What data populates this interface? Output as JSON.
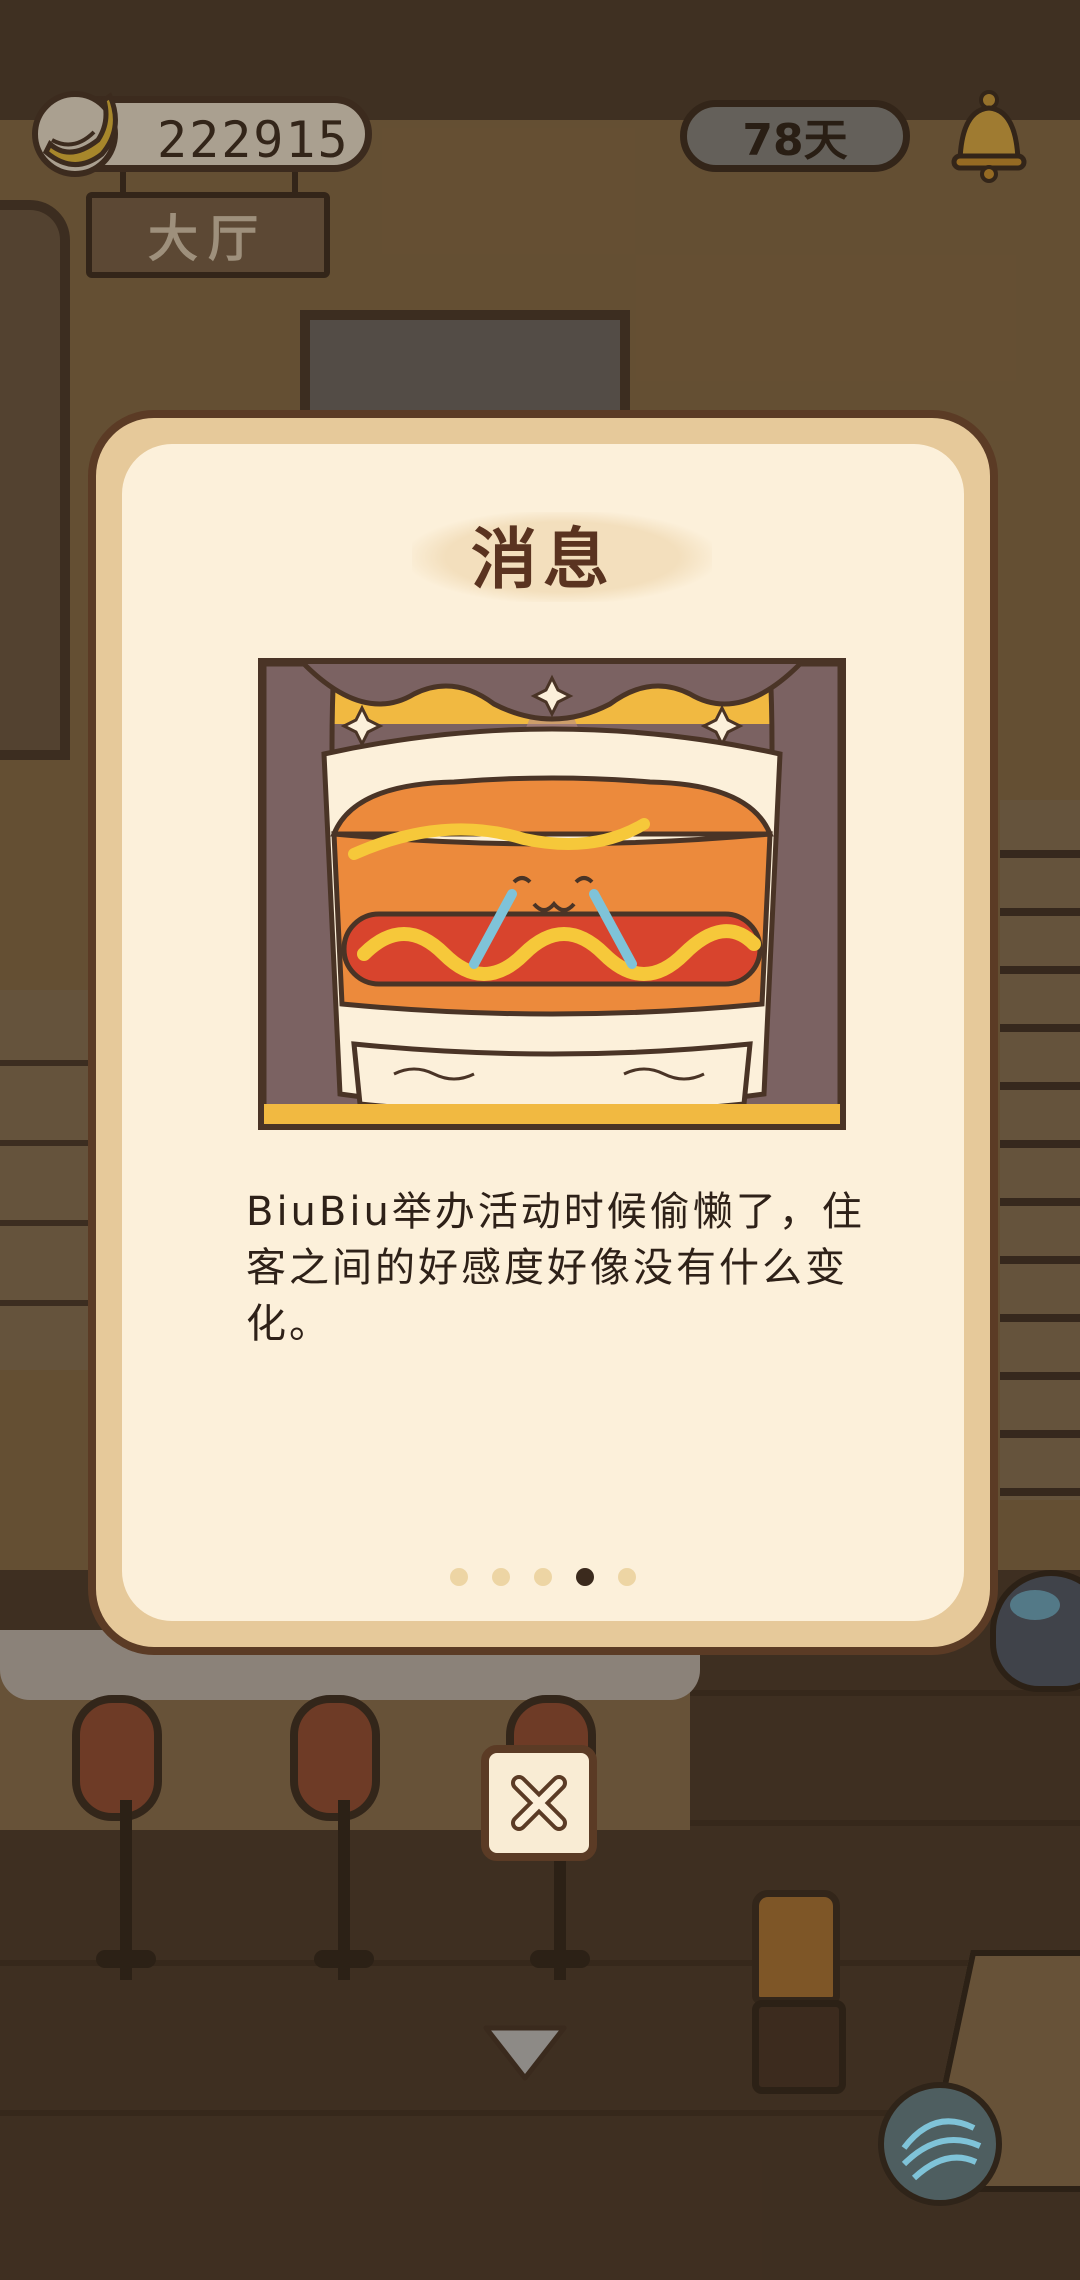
{
  "hud": {
    "banana_count": "222915",
    "days": "78天",
    "room_name": "大厅"
  },
  "dialog": {
    "title": "消息",
    "message": "BiuBiu举办活动时候偷懒了，住客之间的好感度好像没有什么变化。",
    "page_count": 5,
    "active_page": 4
  },
  "icons": {
    "banana": "banana-icon",
    "bell": "bell-icon",
    "close": "close-icon",
    "down_arrow": "chevron-down-icon",
    "yarn": "yarn-ball-icon"
  },
  "colors": {
    "dialog_border": "#5b3b25",
    "dialog_fill": "#fcf0da",
    "accent_gold": "#e6c99a",
    "text_dark": "#2e2118"
  }
}
